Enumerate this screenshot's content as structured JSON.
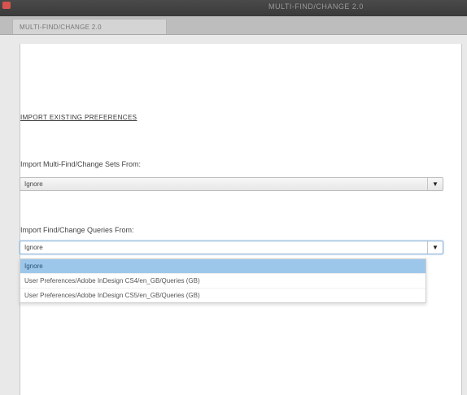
{
  "window": {
    "title": "MULTI-FIND/CHANGE 2.0",
    "tab_label": "MULTI-FIND/CHANGE 2.0"
  },
  "import_section": {
    "heading": "IMPORT EXISTING PREFERENCES",
    "sets_label": "Import Multi-Find/Change Sets From:",
    "sets_value": "Ignore",
    "queries_label": "Import Find/Change Queries From:",
    "queries_value": "Ignore"
  },
  "dropdown": {
    "options": [
      "Ignore",
      "User Preferences/Adobe InDesign CS4/en_GB/Queries (GB)",
      "User Preferences/Adobe InDesign CS5/en_GB/Queries (GB)"
    ],
    "selected_index": 0
  },
  "colors": {
    "selected_highlight": "#9cc7ea",
    "close_button": "#d9534f"
  },
  "icons": {
    "dropdown_arrow": "triangle-down"
  }
}
